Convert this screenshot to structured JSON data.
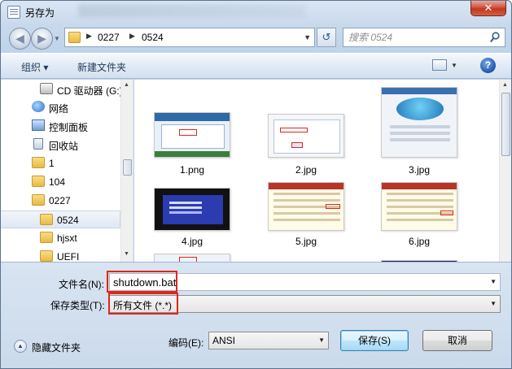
{
  "window": {
    "title": "另存为",
    "close_label": "✕"
  },
  "nav": {
    "breadcrumbs": [
      "0227",
      "0524"
    ],
    "search_placeholder": "搜索 0524"
  },
  "toolbar": {
    "organize_label": "组织 ▾",
    "new_folder_label": "新建文件夹",
    "help_label": "?"
  },
  "sidebar": {
    "items": [
      {
        "label": "CD 驱动器 (G:)",
        "icon": "cd-drive-icon"
      },
      {
        "label": "网络",
        "icon": "network-icon"
      },
      {
        "label": "控制面板",
        "icon": "control-panel-icon"
      },
      {
        "label": "回收站",
        "icon": "recycle-bin-icon"
      },
      {
        "label": "1",
        "icon": "folder-icon"
      },
      {
        "label": "104",
        "icon": "folder-icon"
      },
      {
        "label": "0227",
        "icon": "folder-icon"
      },
      {
        "label": "0524",
        "icon": "folder-icon",
        "selected": true
      },
      {
        "label": "hjsxt",
        "icon": "folder-icon"
      },
      {
        "label": "UEFI",
        "icon": "folder-icon"
      }
    ]
  },
  "files": [
    {
      "name": "1.png"
    },
    {
      "name": "2.jpg"
    },
    {
      "name": "3.jpg"
    },
    {
      "name": "4.jpg"
    },
    {
      "name": "5.jpg"
    },
    {
      "name": "6.jpg"
    }
  ],
  "form": {
    "filename_label": "文件名(N):",
    "filename_value": "shutdown.bat",
    "filetype_label": "保存类型(T):",
    "filetype_value": "所有文件  (*.*)",
    "encoding_label": "编码(E):",
    "encoding_value": "ANSI",
    "hide_folders_label": "隐藏文件夹",
    "save_label": "保存(S)",
    "cancel_label": "取消"
  },
  "colors": {
    "highlight_box": "#e0261b",
    "accent": "#3c7fb1"
  }
}
